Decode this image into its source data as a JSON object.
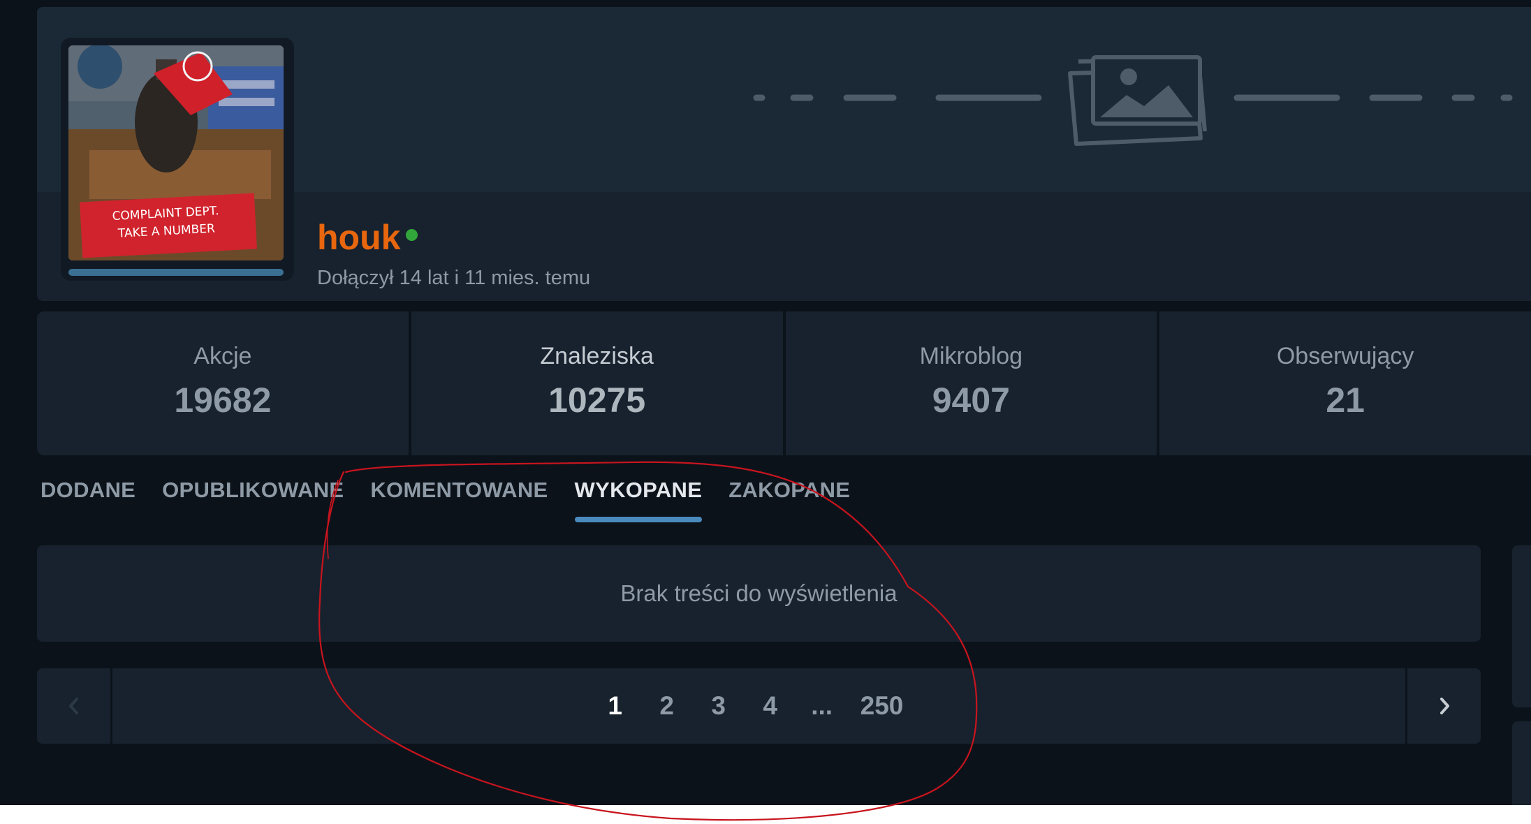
{
  "profile": {
    "username": "houk",
    "joined": "Dołączył 14 lat i 11 mies. temu",
    "avatar_caption_line1": "COMPLAINT DEPT.",
    "avatar_caption_line2": "TAKE A NUMBER",
    "online_status_color": "#33a63b",
    "username_color": "#e8660e"
  },
  "stats": [
    {
      "label": "Akcje",
      "value": "19682"
    },
    {
      "label": "Znaleziska",
      "value": "10275"
    },
    {
      "label": "Mikroblog",
      "value": "9407"
    },
    {
      "label": "Obserwujący",
      "value": "21"
    }
  ],
  "tabs": [
    {
      "label": "DODANE",
      "active": false
    },
    {
      "label": "OPUBLIKOWANE",
      "active": false
    },
    {
      "label": "KOMENTOWANE",
      "active": false
    },
    {
      "label": "WYKOPANE",
      "active": true
    },
    {
      "label": "ZAKOPANE",
      "active": false
    }
  ],
  "content": {
    "empty_message": "Brak treści do wyświetlenia"
  },
  "pagination": {
    "pages": [
      "1",
      "2",
      "3",
      "4",
      "...",
      "250"
    ],
    "current": "1",
    "prev_icon": "chevron-left-icon",
    "next_icon": "chevron-right-icon"
  },
  "colors": {
    "background": "#0b121a",
    "card": "#17222e",
    "accent": "#4a8abd",
    "annotation": "#c8141e"
  }
}
